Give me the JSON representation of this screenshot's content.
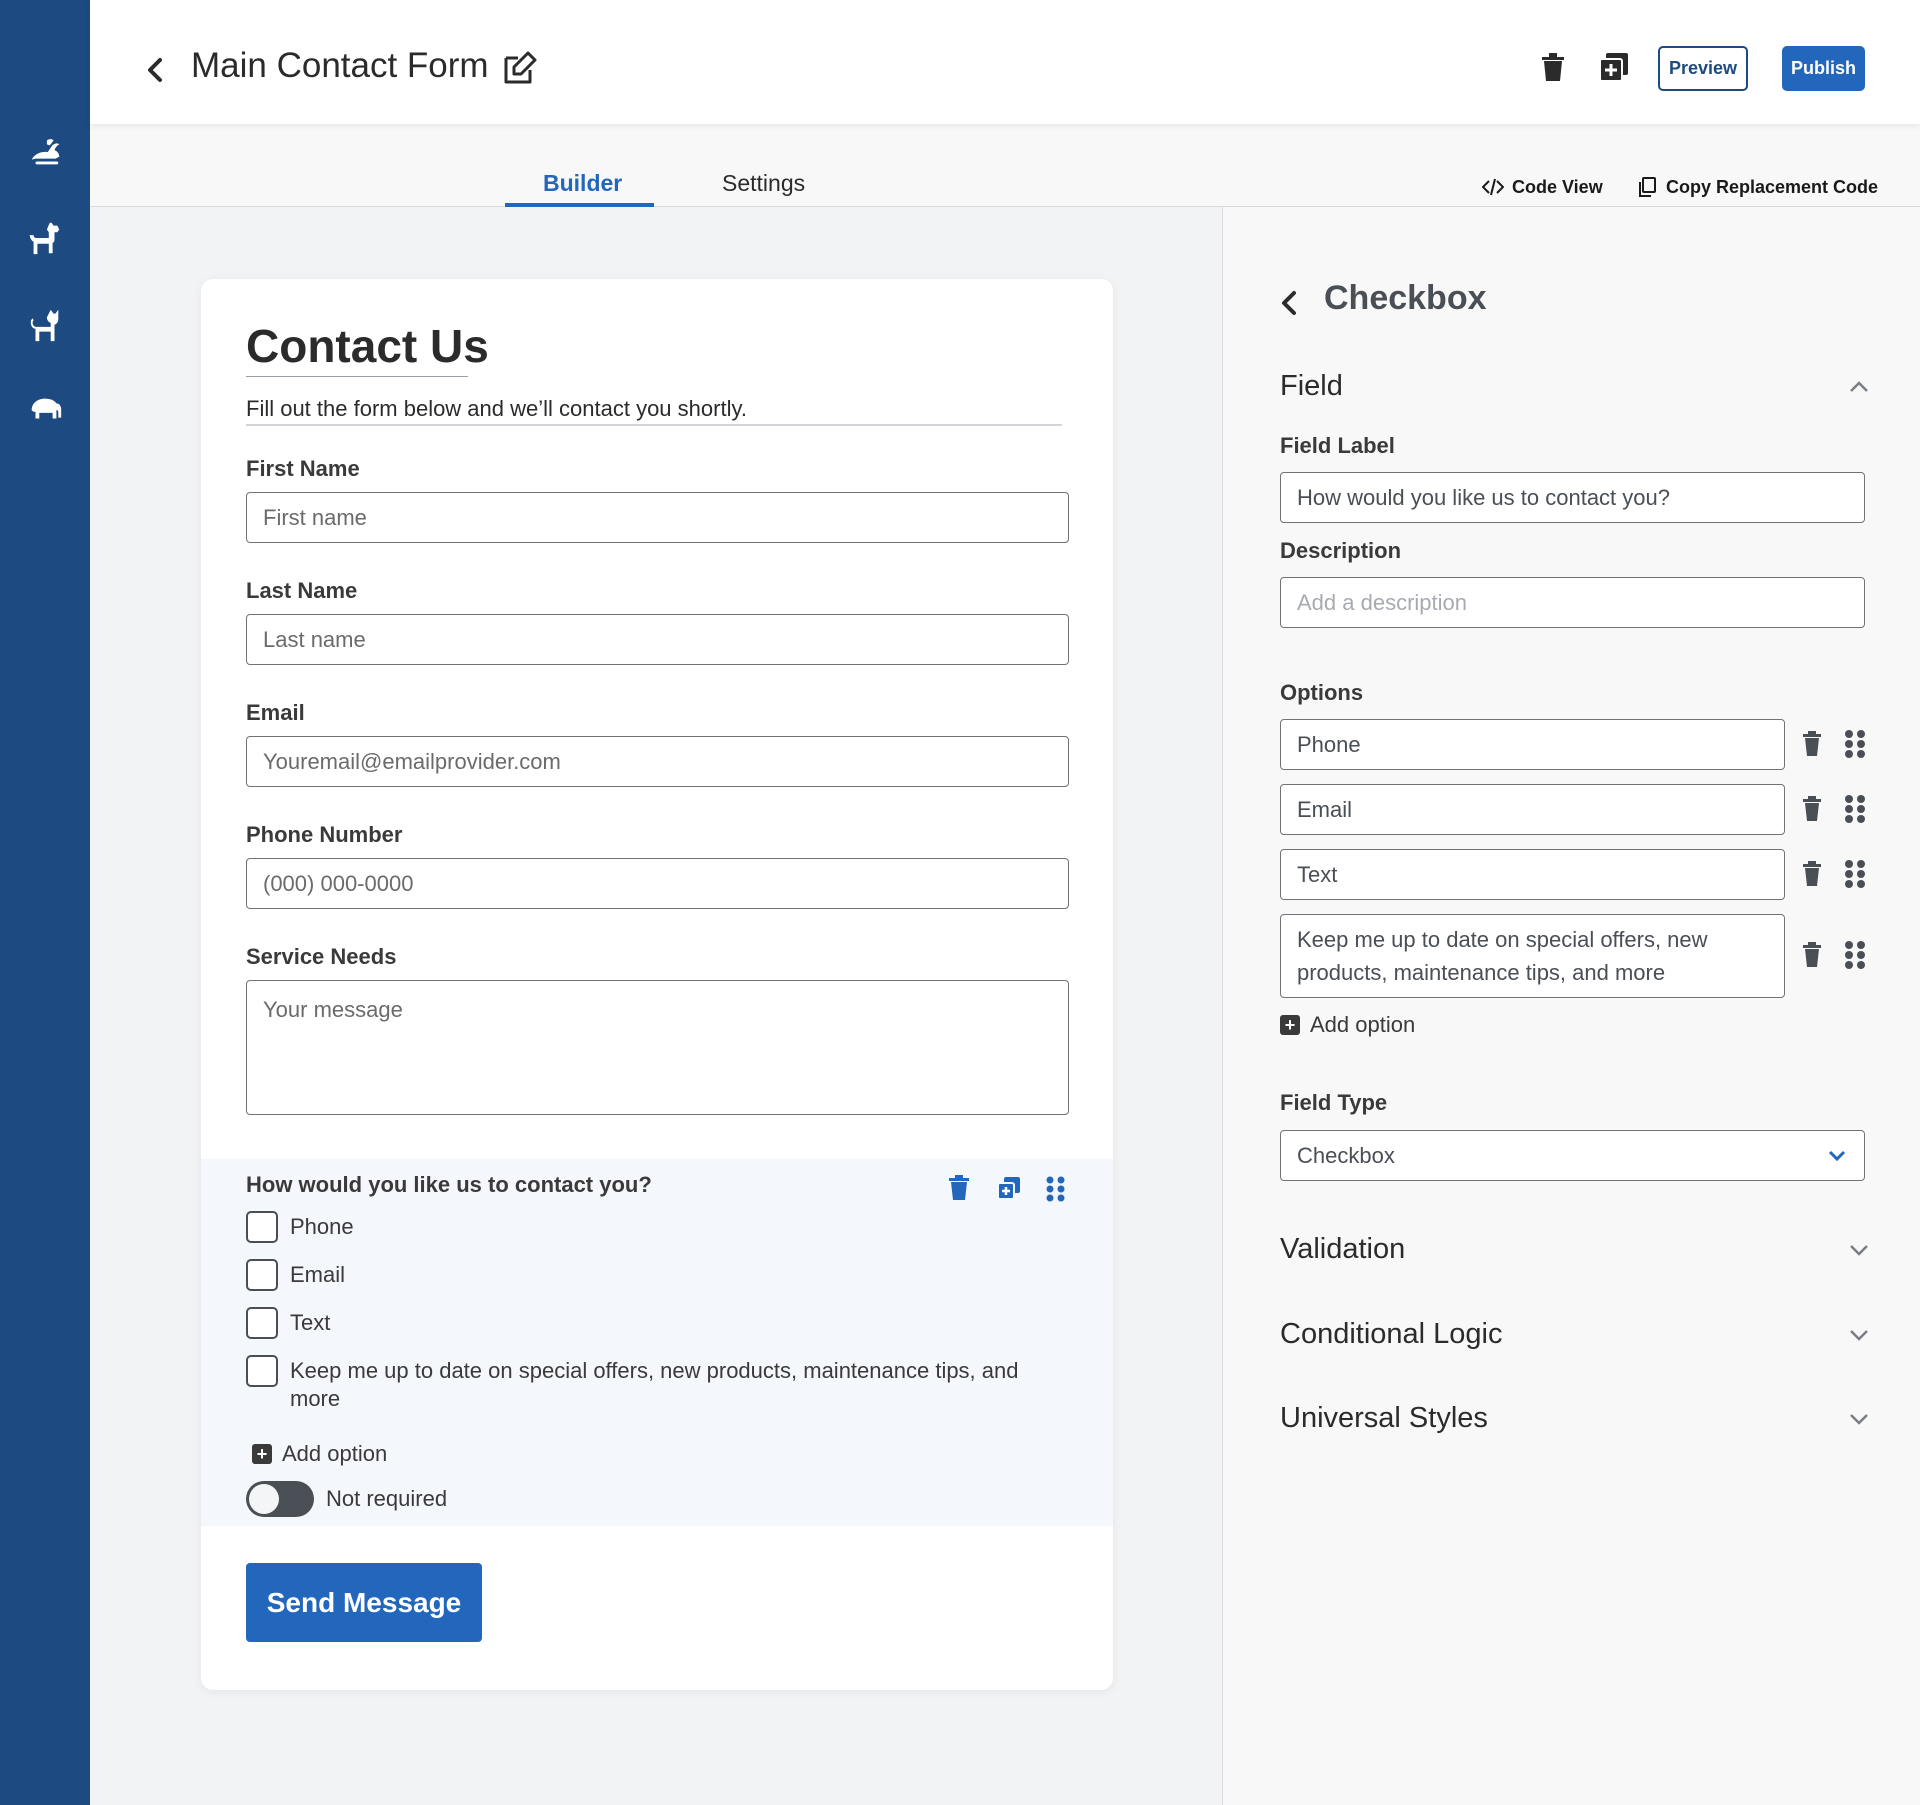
{
  "header": {
    "title": "Main Contact Form",
    "preview_label": "Preview",
    "publish_label": "Publish"
  },
  "tabs": [
    {
      "label": "Builder",
      "active": true
    },
    {
      "label": "Settings",
      "active": false
    }
  ],
  "toolbar": {
    "code_view_label": "Code View",
    "copy_code_label": "Copy Replacement Code"
  },
  "rail": {
    "icons": [
      "rabbit-icon",
      "dog-icon",
      "cat-icon",
      "elephant-icon"
    ]
  },
  "form": {
    "title": "Contact Us",
    "subtitle": "Fill out the form below and we’ll contact you shortly.",
    "fields": [
      {
        "label": "First Name",
        "placeholder": "First name"
      },
      {
        "label": "Last Name",
        "placeholder": "Last name"
      },
      {
        "label": "Email",
        "placeholder": "Youremail@emailprovider.com"
      },
      {
        "label": "Phone Number",
        "placeholder": "(000) 000-0000"
      },
      {
        "label": "Service Needs",
        "placeholder": "Your message"
      }
    ],
    "checkbox_question": "How would you like us to contact you?",
    "checkbox_options": [
      "Phone",
      "Email",
      "Text",
      "Keep me up to date on special offers, new products, maintenance tips, and more"
    ],
    "add_option_label": "Add option",
    "required_toggle_label": "Not required",
    "required": false,
    "submit_label": "Send Message"
  },
  "panel": {
    "title": "Checkbox",
    "field_section": "Field",
    "field_label_label": "Field Label",
    "field_label_value": "How would you like us to contact you?",
    "description_label": "Description",
    "description_placeholder": "Add a description",
    "options_label": "Options",
    "options": [
      "Phone",
      "Email",
      "Text",
      "Keep me up to date on special offers, new products, maintenance tips, and more"
    ],
    "add_option_label": "Add option",
    "field_type_label": "Field Type",
    "field_type_value": "Checkbox",
    "sections": [
      "Validation",
      "Conditional Logic",
      "Universal Styles"
    ]
  },
  "colors": {
    "rail": "#1d4a80",
    "accent": "#2367bd",
    "selected_bg": "#f4f7fb"
  }
}
